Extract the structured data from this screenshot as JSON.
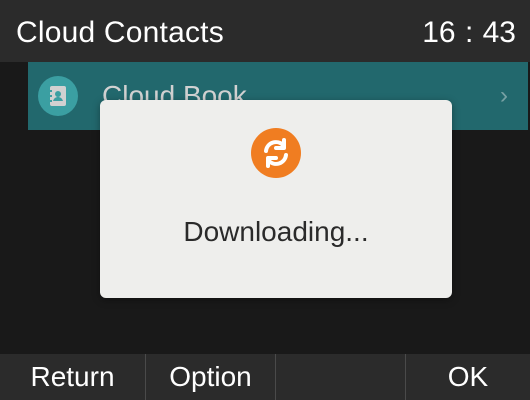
{
  "status_bar": {
    "title": "Cloud Contacts",
    "time": "16 : 43"
  },
  "list": {
    "items": [
      {
        "label": "Cloud Book",
        "icon": "contact-book-icon"
      }
    ]
  },
  "dialog": {
    "message": "Downloading...",
    "icon": "sync-icon"
  },
  "softkeys": {
    "items": [
      {
        "label": "Return"
      },
      {
        "label": "Option"
      },
      {
        "label": ""
      },
      {
        "label": "OK"
      }
    ]
  },
  "colors": {
    "background": "#1f1f1f",
    "bar": "#2b2b2b",
    "selected_item": "#2a7f86",
    "contact_icon": "#49c2c6",
    "dialog": "#eeeeec",
    "accent_orange": "#f07d21"
  }
}
